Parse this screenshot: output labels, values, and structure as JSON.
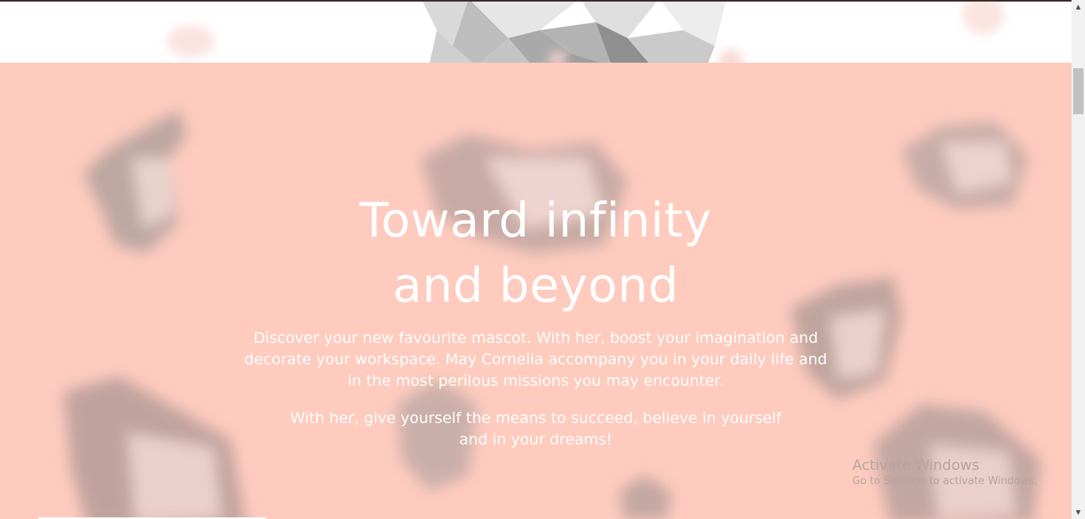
{
  "hero": {
    "title_line1": "Toward infinity",
    "title_line2": "and beyond",
    "paragraph1": "Discover your new favourite mascot. With her, boost your imagination and decorate your workspace. May Cornelia accompany you in your daily life and in the most perilous missions you may encounter.",
    "paragraph2": "With her, give yourself the means to succeed, believe in yourself and in your dreams!",
    "background_color": "#fecbbe",
    "text_color": "#ffffff"
  },
  "watermark": {
    "line1": "Activate Windows",
    "line2": "Go to Settings to activate Windows."
  },
  "icons": {
    "scroll_up": "scroll-up-arrow-icon",
    "scroll_down": "scroll-down-arrow-icon",
    "mascot": "low-poly-elephant-icon"
  }
}
